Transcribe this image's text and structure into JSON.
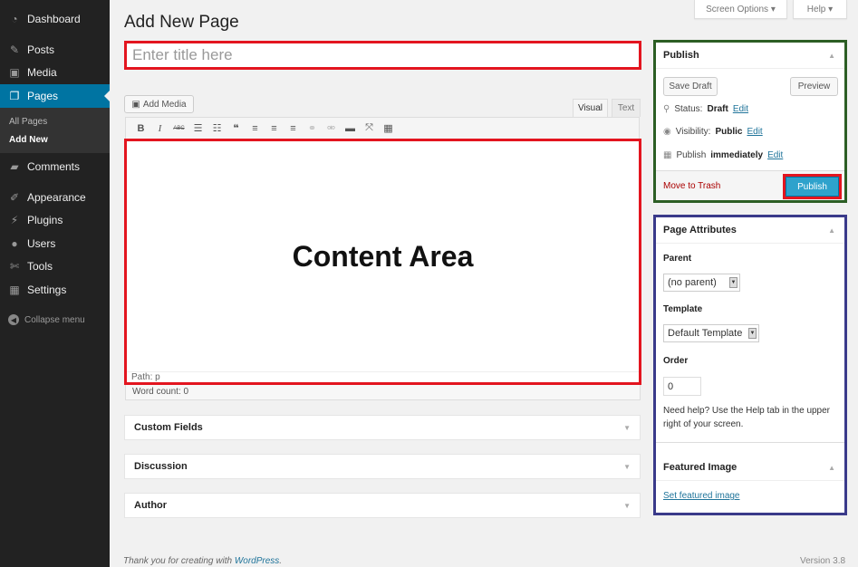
{
  "sidebar": {
    "items": [
      {
        "label": "Dashboard",
        "icon": "dashboard-icon"
      },
      {
        "label": "Posts",
        "icon": "pin-icon"
      },
      {
        "label": "Media",
        "icon": "media-icon"
      },
      {
        "label": "Pages",
        "icon": "pages-icon"
      },
      {
        "label": "Comments",
        "icon": "comment-icon"
      },
      {
        "label": "Appearance",
        "icon": "brush-icon"
      },
      {
        "label": "Plugins",
        "icon": "plug-icon"
      },
      {
        "label": "Users",
        "icon": "user-icon"
      },
      {
        "label": "Tools",
        "icon": "wrench-icon"
      },
      {
        "label": "Settings",
        "icon": "settings-icon"
      }
    ],
    "submenu": [
      "All Pages",
      "Add New"
    ],
    "collapse": "Collapse menu"
  },
  "header": {
    "title": "Add New Page",
    "screen_options": "Screen Options",
    "help": "Help"
  },
  "editor": {
    "title_placeholder": "Enter title here",
    "add_media": "Add Media",
    "tab_visual": "Visual",
    "tab_text": "Text",
    "toolbar": {
      "bold": "B",
      "italic": "I",
      "strike": "ABC",
      "ul": "☰",
      "ol": "☷",
      "quote": "❝",
      "align_left": "≡",
      "align_center": "≡",
      "align_right": "≡",
      "link": "⚭",
      "unlink": "⚮",
      "more": "▬",
      "fullscreen": "⤧",
      "kitchen": "▦"
    },
    "content_label": "Content Area",
    "path": "Path: p",
    "word_count": "Word count: 0"
  },
  "metaboxes": {
    "custom_fields": "Custom Fields",
    "discussion": "Discussion",
    "author": "Author"
  },
  "publish": {
    "title": "Publish",
    "save_draft": "Save Draft",
    "preview": "Preview",
    "status_label": "Status:",
    "status_value": "Draft",
    "visibility_label": "Visibility:",
    "visibility_value": "Public",
    "publish_label": "Publish",
    "publish_value": "immediately",
    "edit": "Edit",
    "move_to_trash": "Move to Trash",
    "publish_button": "Publish"
  },
  "page_attributes": {
    "title": "Page Attributes",
    "parent_label": "Parent",
    "parent_value": "(no parent)",
    "template_label": "Template",
    "template_value": "Default Template",
    "order_label": "Order",
    "order_value": "0",
    "help_text": "Need help? Use the Help tab in the upper right of your screen."
  },
  "featured_image": {
    "title": "Featured Image",
    "link": "Set featured image"
  },
  "footer": {
    "thanks": "Thank you for creating with",
    "wordpress": "WordPress",
    "version": "Version 3.8"
  },
  "colors": {
    "highlight_red": "#e3151f",
    "publish_green": "#2c5e24",
    "attributes_blue": "#3a3a8a",
    "publish_button": "#2ea2cc",
    "sidebar_active": "#0074a2"
  }
}
